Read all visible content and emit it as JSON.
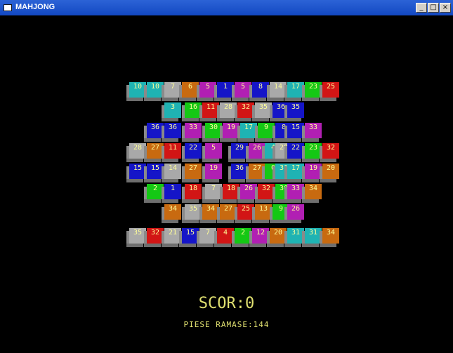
{
  "window": {
    "title": "MAHJONG"
  },
  "titlebar_buttons": {
    "minimize": "_",
    "maximize": "□",
    "close": "×"
  },
  "palette": {
    "teal": "#1fb3b3",
    "gray": "#a9a9a9",
    "orange": "#c86a10",
    "magenta": "#b11fb3",
    "blue": "#1515c8",
    "red": "#d21515",
    "green": "#14c814"
  },
  "rows": [
    [
      "10",
      "10",
      "7",
      "6",
      "5",
      "1",
      "5",
      "8",
      "14",
      "17",
      "23",
      "25"
    ],
    [
      "3",
      "16",
      "11",
      "28",
      "32",
      "35",
      "36",
      "35"
    ],
    [
      "36",
      "36",
      "33",
      "30",
      "19",
      "17",
      "9",
      "8",
      "15",
      "33"
    ],
    [
      "28",
      "27",
      "11",
      "22",
      "5",
      "29",
      "26",
      "4",
      "28",
      "22",
      "23",
      "32"
    ],
    [
      "15",
      "15",
      "14",
      "27",
      "19",
      "36",
      "27",
      "0",
      "31",
      "17",
      "19",
      "20"
    ],
    [
      "2",
      "1",
      "18",
      "7",
      "18",
      "26",
      "32",
      "30",
      "33",
      "34"
    ],
    [
      "34",
      "35",
      "34",
      "27",
      "25",
      "13",
      "9",
      "26"
    ],
    [
      "35",
      "32",
      "21",
      "15",
      "7",
      "4",
      "2",
      "12",
      "20",
      "31",
      "31",
      "34"
    ]
  ],
  "score": {
    "label": "SCOR:0"
  },
  "remaining": {
    "label": "PIESE RAMASE:144"
  }
}
